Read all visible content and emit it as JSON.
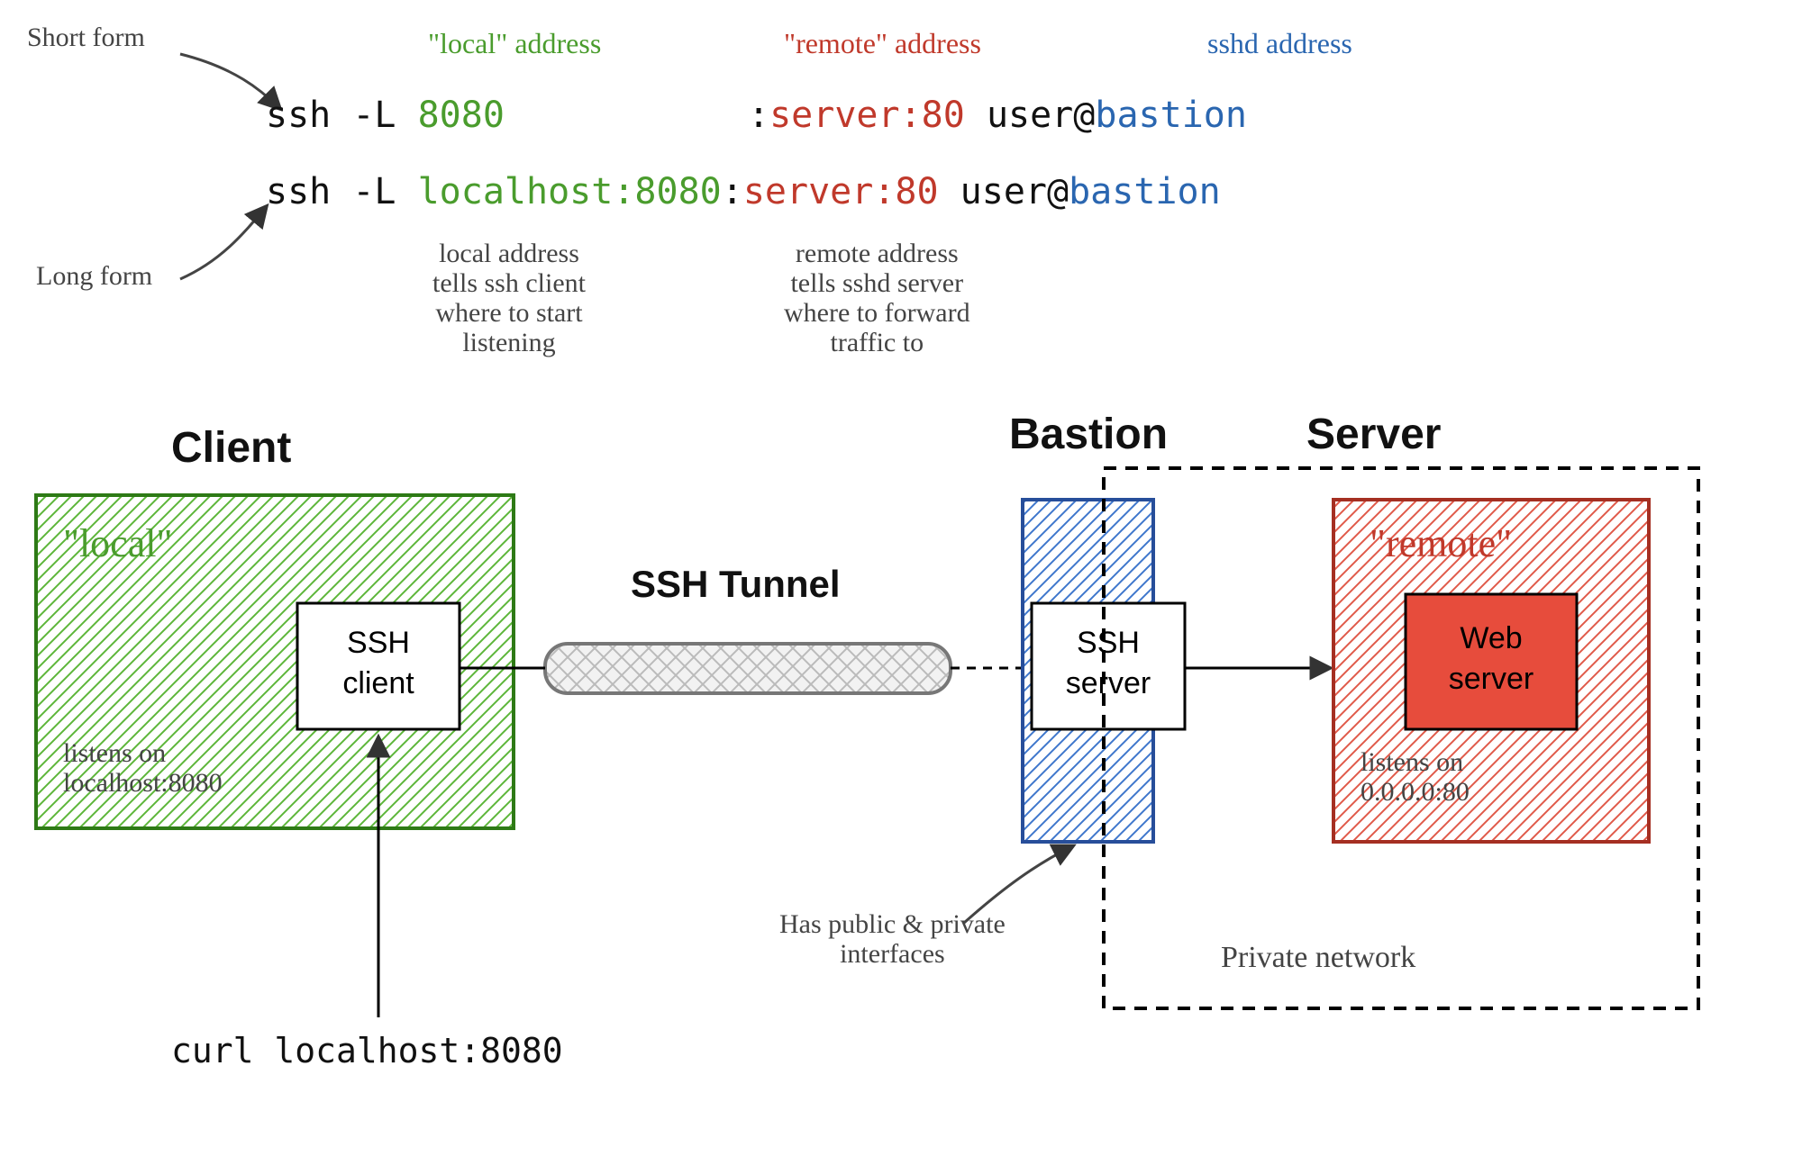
{
  "annotations": {
    "short_form": "Short form",
    "long_form": "Long form",
    "local_head": "\"local\" address",
    "remote_head": "\"remote\" address",
    "sshd_head": "sshd address",
    "local_note": "local address\ntells ssh client\nwhere to start\nlistening",
    "remote_note": "remote address\ntells sshd server\nwhere to forward\ntraffic to",
    "bastion_note": "Has public & private\ninterfaces",
    "private_net": "Private network",
    "curl_cmd": "curl localhost:8080"
  },
  "cmd": {
    "prefix": "ssh -L ",
    "short_local": "8080",
    "long_local": "localhost:8080",
    "colon": ":",
    "remote": "server:80",
    "space": " ",
    "user_at": "user@",
    "target": "bastion"
  },
  "boxes": {
    "client_title": "Client",
    "bastion_title": "Bastion",
    "server_title": "Server",
    "tunnel_label": "SSH Tunnel",
    "local_badge": "\"local\"",
    "remote_badge": "\"remote\"",
    "ssh_client": "SSH\nclient",
    "ssh_server": "SSH\nserver",
    "web_server": "Web\nserver",
    "local_listen": "listens on\nlocalhost:8080",
    "remote_listen": "listens on\n0.0.0.0:80"
  }
}
